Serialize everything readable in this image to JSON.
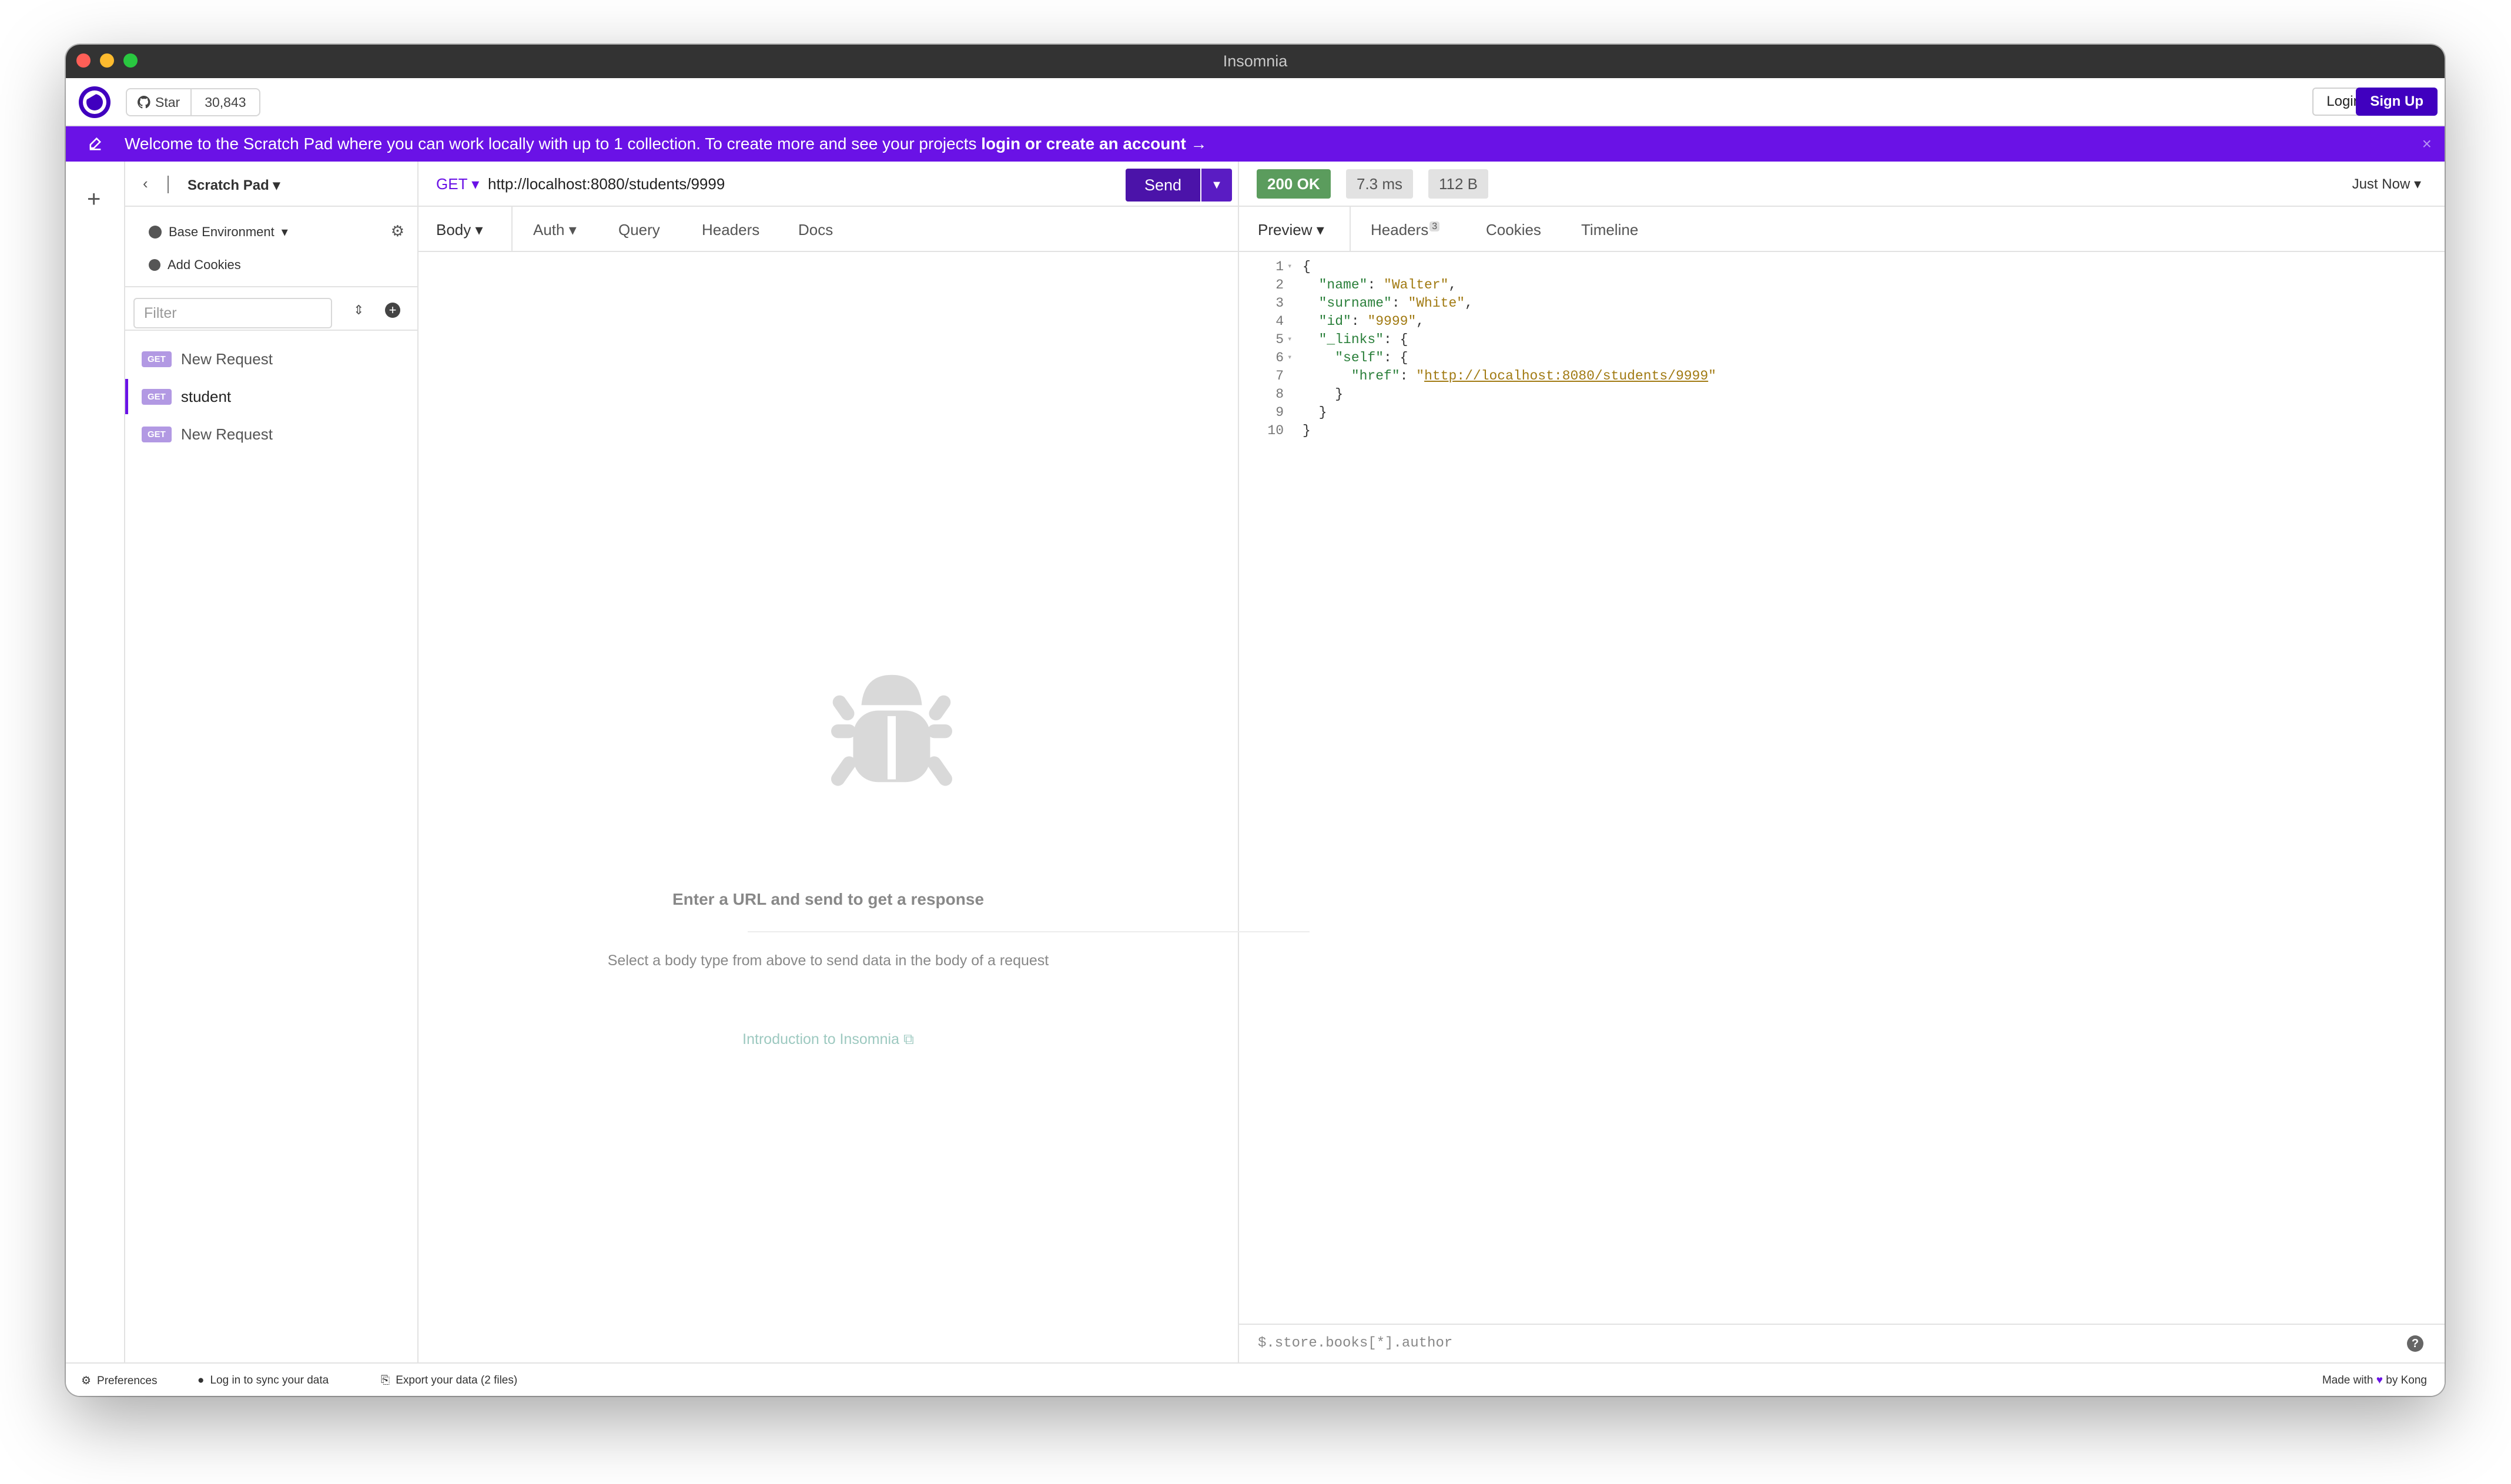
{
  "window": {
    "title": "Insomnia"
  },
  "header": {
    "star_label": "Star",
    "star_count": "30,843",
    "login_label": "Login",
    "signup_label": "Sign Up"
  },
  "banner": {
    "text": "Welcome to the Scratch Pad where you can work locally with up to 1 collection. To create more and see your projects ",
    "link": "login or create an account →",
    "close": "×"
  },
  "sidebar": {
    "back": "‹",
    "project_name": "Scratch Pad",
    "environment": "Base Environment",
    "cookies": "Add Cookies",
    "filter_placeholder": "Filter",
    "requests": [
      {
        "method": "GET",
        "name": "New Request"
      },
      {
        "method": "GET",
        "name": "student"
      },
      {
        "method": "GET",
        "name": "New Request"
      }
    ]
  },
  "request": {
    "method": "GET",
    "url": "http://localhost:8080/students/9999",
    "send_label": "Send",
    "tabs": [
      "Body",
      "Auth",
      "Query",
      "Headers",
      "Docs"
    ],
    "empty_title": "Enter a URL and send to get a response",
    "empty_sub": "Select a body type from above to send data in the body of a request",
    "empty_link": "Introduction to Insomnia"
  },
  "response": {
    "status": "200 OK",
    "time": "7.3 ms",
    "size": "112 B",
    "when": "Just Now",
    "tabs": [
      "Preview",
      "Headers",
      "Cookies",
      "Timeline"
    ],
    "headers_count": "3",
    "body_lines": [
      "{",
      "  \"name\": \"Walter\",",
      "  \"surname\": \"White\",",
      "  \"id\": \"9999\",",
      "  \"_links\": {",
      "    \"self\": {",
      "      \"href\": \"http://localhost:8080/students/9999\"",
      "    }",
      "  }",
      "}"
    ],
    "filter_placeholder": "$.store.books[*].author"
  },
  "footer": {
    "preferences": "Preferences",
    "sync": "Log in to sync your data",
    "export": "Export your data (2 files)",
    "made_with": "Made with",
    "by": "by Kong"
  },
  "colors": {
    "accent": "#4000bf",
    "banner": "#6a12e6",
    "ok": "#5b9c5d"
  }
}
